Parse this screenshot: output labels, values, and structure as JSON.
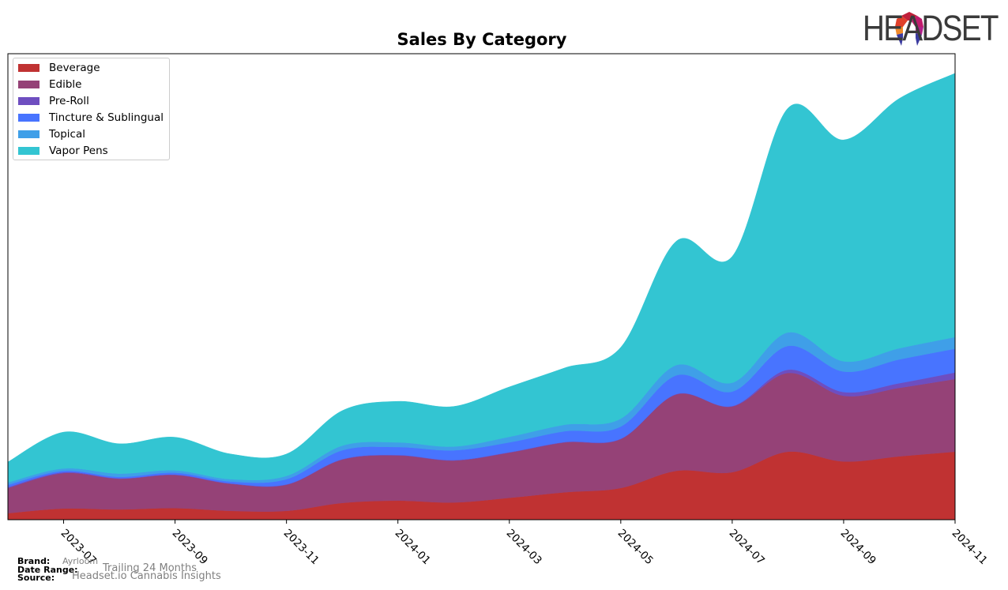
{
  "header": {
    "brand_logo_text": "HEADSET"
  },
  "chart_data": {
    "type": "area",
    "stacked": true,
    "title": "Sales By Category",
    "xlabel": "",
    "ylabel": "",
    "x": [
      "2023-06",
      "2023-07",
      "2023-08",
      "2023-09",
      "2023-10",
      "2023-11",
      "2023-12",
      "2024-01",
      "2024-02",
      "2024-03",
      "2024-04",
      "2024-05",
      "2024-06",
      "2024-07",
      "2024-08",
      "2024-09",
      "2024-10",
      "2024-11"
    ],
    "x_tick_labels": [
      "2023-07",
      "2023-09",
      "2023-11",
      "2024-01",
      "2024-03",
      "2024-05",
      "2024-07",
      "2024-09",
      "2024-11"
    ],
    "ylim": [
      0,
      100
    ],
    "y_ticks_visible": false,
    "grid": false,
    "legend_position": "top-left",
    "series": [
      {
        "name": "Beverage",
        "color": "#c03232",
        "values": [
          1.4,
          2.4,
          2.2,
          2.5,
          1.9,
          1.9,
          3.6,
          4.1,
          3.7,
          4.7,
          5.9,
          6.8,
          10.5,
          10.2,
          14.6,
          12.5,
          13.6,
          14.6
        ]
      },
      {
        "name": "Edible",
        "color": "#954277",
        "values": [
          5.4,
          7.6,
          6.6,
          7.1,
          5.8,
          5.6,
          9.3,
          9.7,
          9.0,
          9.7,
          10.7,
          10.5,
          16.4,
          14.1,
          16.9,
          14.1,
          14.7,
          15.6
        ]
      },
      {
        "name": "Pre-Roll",
        "color": "#6e4ec0",
        "values": [
          0.2,
          0.2,
          0.1,
          0.1,
          0.1,
          0.1,
          0.1,
          0.1,
          0.1,
          0.1,
          0.1,
          0.1,
          0.1,
          0.1,
          0.7,
          0.8,
          1.0,
          1.4
        ]
      },
      {
        "name": "Tincture & Sublingual",
        "color": "#4874ff",
        "values": [
          0.5,
          0.3,
          0.3,
          0.4,
          0.4,
          1.1,
          1.9,
          1.7,
          2.1,
          2.1,
          2.3,
          2.6,
          4.0,
          3.1,
          5.1,
          4.4,
          5.1,
          5.1
        ]
      },
      {
        "name": "Topical",
        "color": "#3f9fe8",
        "values": [
          0.5,
          0.5,
          0.7,
          0.5,
          0.5,
          0.7,
          1.0,
          1.0,
          0.8,
          1.2,
          1.4,
          1.7,
          2.2,
          1.9,
          2.9,
          2.2,
          2.4,
          2.5
        ]
      },
      {
        "name": "Vapor Pens",
        "color": "#33c5d2",
        "values": [
          4.4,
          7.8,
          6.4,
          7.1,
          5.4,
          4.7,
          7.5,
          8.8,
          8.6,
          10.7,
          12.2,
          15.3,
          26.6,
          27.1,
          48.1,
          47.5,
          53.6,
          56.6
        ]
      }
    ]
  },
  "footer": {
    "brand_label": "Brand:",
    "brand_value": "Ayrloom",
    "date_range_label": "Date Range:",
    "date_range_value": "Trailing 24 Months",
    "source_label": "Source:",
    "source_value": "Headset.io Cannabis Insights"
  }
}
